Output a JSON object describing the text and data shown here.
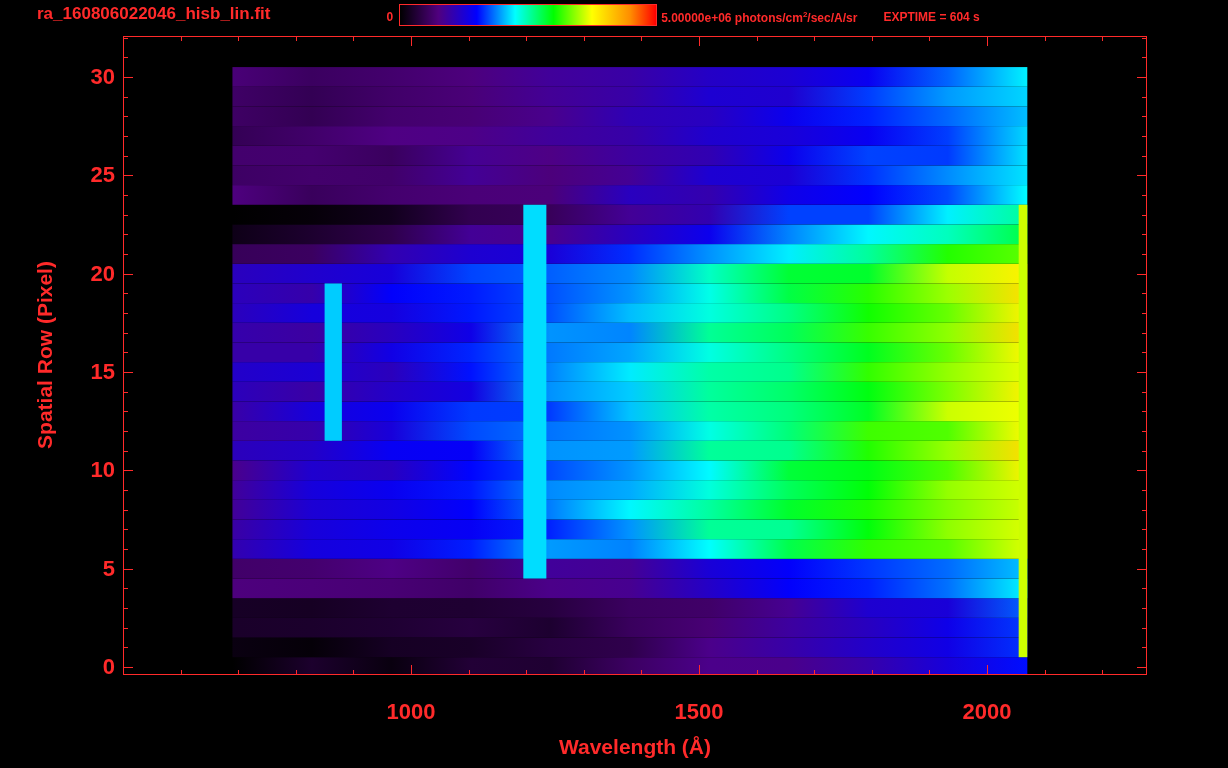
{
  "header": {
    "file_name": "ra_160806022046_hisb_lin.fit",
    "colorbar_min": "0",
    "colorbar_max": "5.00000e+06 photons/cm$^{2}$/sec/A/sr",
    "exposure": "EXPTIME = 604 s"
  },
  "y_axis": {
    "title": "Spatial Row (Pixel)",
    "ticks": [
      "30",
      "25",
      "20",
      "15",
      "10",
      "5",
      "0"
    ]
  },
  "x_axis": {
    "title": "Wavelength (Å)",
    "ticks": [
      "1000",
      "1500",
      "2000"
    ]
  }
}
